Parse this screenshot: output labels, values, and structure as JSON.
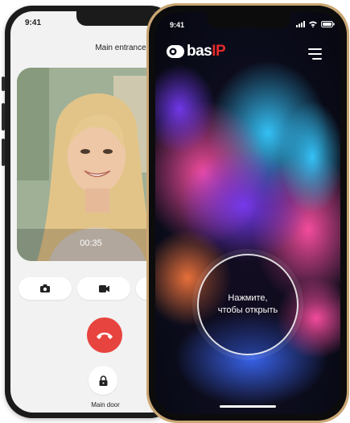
{
  "back_phone": {
    "time": "9:41",
    "title": "Main entrance",
    "call_timer": "00:35",
    "controls": [
      {
        "icon": "camera-icon"
      },
      {
        "icon": "video-icon"
      }
    ],
    "hangup_icon": "phone-hangup-icon",
    "door_icon": "lock-icon",
    "door_label": "Main door",
    "colors": {
      "hangup": "#e8443f",
      "background": "#f2f2f2"
    }
  },
  "front_phone": {
    "time": "9:41",
    "brand": {
      "name": "bas",
      "suffix": "IP"
    },
    "open_button_label_line1": "Нажмите,",
    "open_button_label_line2": "чтобы открыть",
    "colors": {
      "accent": "#e52a2a",
      "frame": "#caa774"
    }
  }
}
